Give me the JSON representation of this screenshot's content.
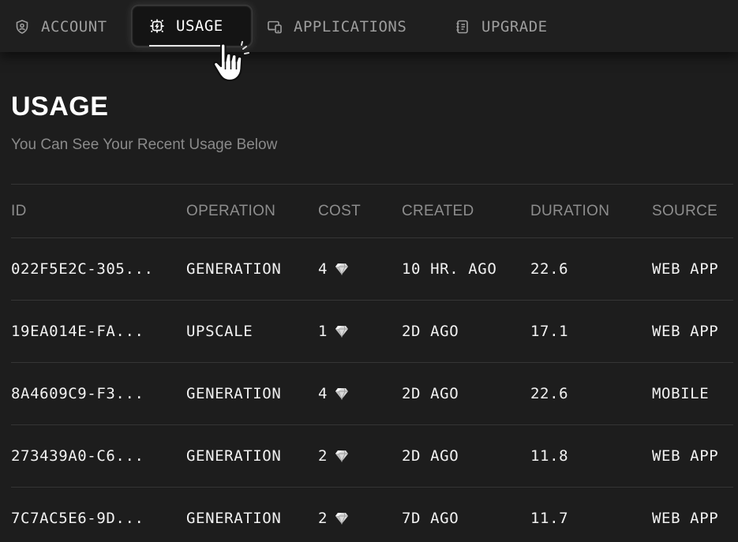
{
  "tabs": [
    {
      "label": "ACCOUNT",
      "icon": "shield-user-icon",
      "active": false
    },
    {
      "label": "USAGE",
      "icon": "chip-icon",
      "active": true
    },
    {
      "label": "APPLICATIONS",
      "icon": "devices-icon",
      "active": false
    },
    {
      "label": "UPGRADE",
      "icon": "notebook-icon",
      "active": false
    }
  ],
  "cursor_icon": "pointer-hand-icon",
  "page": {
    "title": "USAGE",
    "subtitle": "You Can See Your Recent Usage Below"
  },
  "table": {
    "columns": [
      "ID",
      "OPERATION",
      "COST",
      "CREATED",
      "DURATION",
      "SOURCE"
    ],
    "cost_icon": "diamond-icon",
    "rows": [
      {
        "id": "022F5E2C-305...",
        "operation": "GENERATION",
        "cost": "4",
        "created": "10 HR. AGO",
        "duration": "22.6",
        "source": "WEB APP"
      },
      {
        "id": "19EA014E-FA...",
        "operation": "UPSCALE",
        "cost": "1",
        "created": "2D AGO",
        "duration": "17.1",
        "source": "WEB APP"
      },
      {
        "id": "8A4609C9-F3...",
        "operation": "GENERATION",
        "cost": "4",
        "created": "2D AGO",
        "duration": "22.6",
        "source": "MOBILE"
      },
      {
        "id": "273439A0-C6...",
        "operation": "GENERATION",
        "cost": "2",
        "created": "2D AGO",
        "duration": "11.8",
        "source": "WEB APP"
      },
      {
        "id": "7C7AC5E6-9D...",
        "operation": "GENERATION",
        "cost": "2",
        "created": "7D AGO",
        "duration": "11.7",
        "source": "WEB APP"
      }
    ]
  },
  "colors": {
    "background": "#1d1d1d",
    "text_primary": "#f2f2f2",
    "text_muted": "#8d8d8d",
    "divider": "#353535",
    "active_tab_bg": "#141414"
  }
}
